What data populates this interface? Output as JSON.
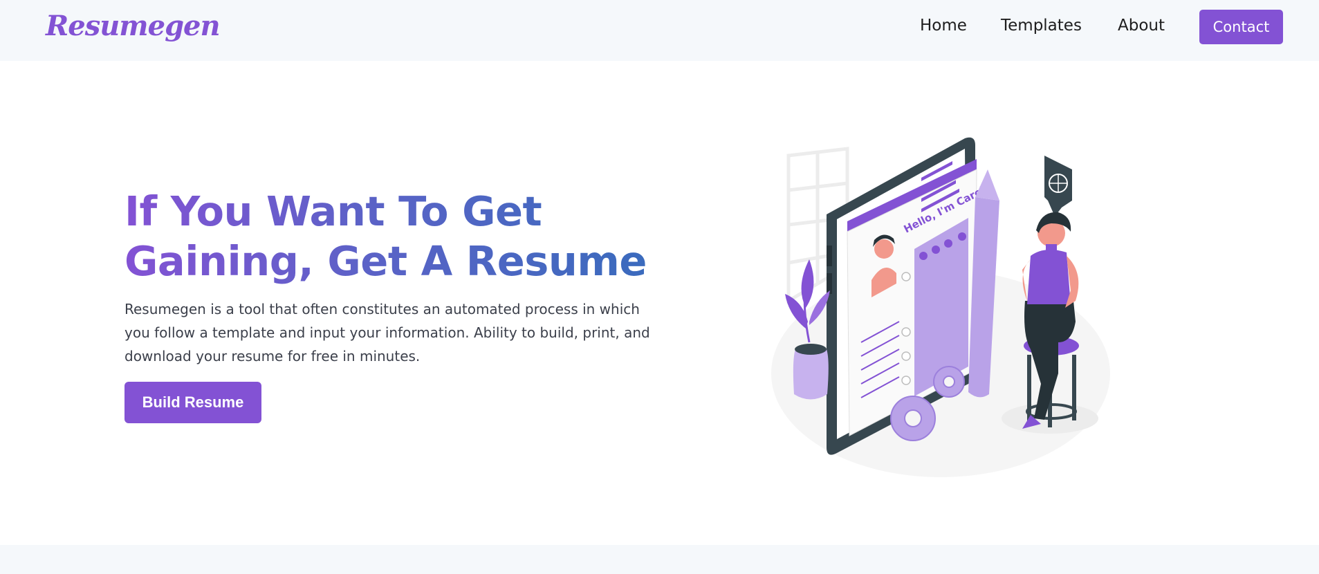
{
  "brand": {
    "name": "Resumegen",
    "accent_color": "#8352d4"
  },
  "nav": {
    "items": [
      {
        "label": "Home"
      },
      {
        "label": "Templates"
      },
      {
        "label": "About"
      }
    ],
    "contact_label": "Contact"
  },
  "hero": {
    "title_line1": "If You Want To Get",
    "title_line2": "Gaining, Get A Resume",
    "description": "Resumegen is a tool that often constitutes an automated process in which you follow a template and input your information. Ability to build, print, and download your resume for free in minutes.",
    "cta_label": "Build Resume"
  },
  "illustration": {
    "caption": "Hello, I'm Carol!",
    "icon": "resume-builder-illustration"
  }
}
